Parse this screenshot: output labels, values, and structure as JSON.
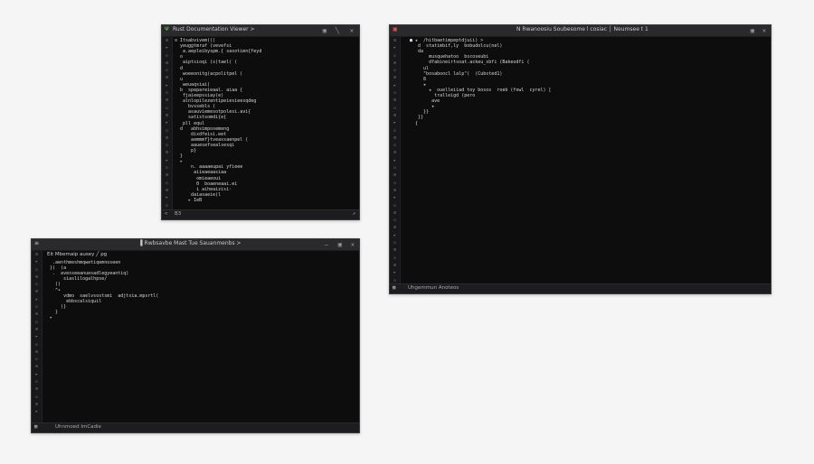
{
  "windows": [
    {
      "title": "Rust Documentation Viewer  >",
      "title_icon": "Ψ",
      "controls": [
        "▣",
        "╲",
        "✕"
      ],
      "status": "B3",
      "status_right": "↗",
      "gutter": [
        "≡",
        "▸",
        "▫",
        "≡",
        "▫",
        "≡",
        "▸",
        "▫",
        "≡",
        "▫",
        "≡",
        "▸",
        "▫",
        "≡",
        "▫",
        "≡",
        "▸",
        "▫",
        "≡",
        "▫",
        "≡",
        "▸",
        "▫",
        "≡",
        "▫"
      ],
      "lines": [
        {
          "t": "≡ Itsabvivem(()",
          "c": "c-white"
        },
        {
          "t": "  yeuggtmraf (vevefsi",
          "c": "c-white"
        },
        {
          "t": "   a.aepleibyspm.{ sasotimn{feyd",
          "c": "c-blue"
        },
        {
          "t": "  o",
          "c": "c-white"
        },
        {
          "t": "   aiptsioqi (s)tael( (",
          "c": "c-white"
        },
        {
          "t": "  d",
          "c": "c-white"
        },
        {
          "t": "   woeeonitg(acpolitpel (",
          "c": "c-white"
        },
        {
          "t": "  u",
          "c": "c-white"
        },
        {
          "t": "   weuaqsiai)",
          "c": "c-white"
        },
        {
          "t": "  b  spepareieaal. aiaa {",
          "c": "c-white"
        },
        {
          "t": "   fjaieepssiay(e)",
          "c": "c-white"
        },
        {
          "t": "   alnlopilezentipeiesieesqdeg",
          "c": "c-cyan"
        },
        {
          "t": "     bvssebls (",
          "c": "c-white"
        },
        {
          "t": "     asauviemesotpolesi.avi{",
          "c": "c-white"
        },
        {
          "t": "     satistsomdi{e{",
          "c": "c-white"
        },
        {
          "t": "   pll equl",
          "c": "c-white"
        },
        {
          "t": "  d   abhsimposemeng",
          "c": "c-white"
        },
        {
          "t": "      dixdfeisi.eet",
          "c": "c-white"
        },
        {
          "t": "      aemmmf}tveaxsaenpel (",
          "c": "c-white"
        },
        {
          "t": "      aauesefsealsesqi",
          "c": "c-white"
        },
        {
          "t": "      p}",
          "c": "c-white"
        },
        {
          "t": "  }",
          "c": "c-white"
        },
        {
          "t": "  ▸",
          "c": "c-white"
        },
        {
          "t": "      n. aaaaeupai yfieee",
          "c": "c-cyan"
        },
        {
          "t": "       aiieaeaasiaa",
          "c": "c-white"
        },
        {
          "t": "        omieaeoui",
          "c": "c-white"
        },
        {
          "t": "        0  boaeneaai.ei",
          "c": "c-white"
        },
        {
          "t": "        i aiheaizisi·",
          "c": "c-white"
        },
        {
          "t": "      daiasaeie(l",
          "c": "c-white"
        },
        {
          "t": "     ▸ IeB",
          "c": "c-white"
        }
      ]
    },
    {
      "title": "N Rwanoosiu Soubesome l cosiac │ Neumsee t 1",
      "title_icon": "▣",
      "controls": [
        "▣",
        "✕"
      ],
      "status": "Uhgemmun Anoteos",
      "status_right": "",
      "gutter": [
        "≡",
        "▸",
        "▫",
        "≡",
        "▫",
        "≡",
        "▸",
        "▫",
        "≡",
        "▫",
        "≡",
        "▸",
        "▫",
        "≡",
        "▫",
        "≡",
        "▸",
        "▫",
        "≡",
        "▫",
        "≡",
        "▸",
        "▫",
        "≡",
        "▫",
        "≡",
        "▸",
        "▫",
        "≡",
        "▫",
        "≡",
        "▸",
        "▫",
        "≡"
      ],
      "lines": [
        {
          "t": "■ ★  /hitbaetimpeptdjuii) >",
          "c": "c-white"
        },
        {
          "t": "   d  statimbif,ly  bobudolcu(nel)",
          "c": "c-white"
        },
        {
          "t": "   da",
          "c": "c-white"
        },
        {
          "t": "       musquehatoo  bscoseubi",
          "c": "c-white"
        },
        {
          "t": "       dfabineirtsoat.ackeu_sbfi (Bakeodfi (",
          "c": "c-yellow"
        },
        {
          "t": "     ul",
          "c": "c-white"
        },
        {
          "t": "     \"bosaboocl lalp\"(  (Cubsted1)",
          "c": "c-yellow"
        },
        {
          "t": "     8",
          "c": "c-white"
        },
        {
          "t": "     ★",
          "c": "c-white"
        },
        {
          "t": "       ★  ouelleiiad toy bosos  roeb (fowl  cyrel) [",
          "c": "c-green"
        },
        {
          "t": "         tralleigd (pero",
          "c": "c-white"
        },
        {
          "t": "        ave",
          "c": "c-white"
        },
        {
          "t": "        ★",
          "c": "c-white"
        },
        {
          "t": "     }}",
          "c": "c-white"
        },
        {
          "t": "   }}",
          "c": "c-white"
        },
        {
          "t": "  {",
          "c": "c-white"
        }
      ]
    },
    {
      "title": "▐ Rwbsavbe Mast Tue Sauanmenbs  >",
      "title_icon": "≡",
      "controls": [
        "―",
        "▣",
        "✕"
      ],
      "left_label": "Eit Mbemaip ausey ╱  pg",
      "status": "Uhnmoed ImCadie",
      "status_right": "",
      "gutter": [
        "≡",
        "▸",
        "▫",
        "≡",
        "▫",
        "≡",
        "▸",
        "▫",
        "≡",
        "▫",
        "≡",
        "▸",
        "▫",
        "≡",
        "▫",
        "≡",
        "▸",
        "▫",
        "≡",
        "▫",
        "≡",
        "▸"
      ],
      "lines": [
        {
          "t": "   .aenthmeshmqwetiqemnoseen",
          "c": "c-white"
        },
        {
          "t": "  })  (a",
          "c": "c-white"
        },
        {
          "t": "   .  avesseeanuesadlegyeantiq)",
          "c": "c-white"
        },
        {
          "t": "       siaslilogalhpse/",
          "c": "c-white"
        },
        {
          "t": "    ))",
          "c": "c-white"
        },
        {
          "t": "    ^•",
          "c": "c-white"
        },
        {
          "t": "       vdmo  saelvsostsmi  adjtsia.mpsrtl(",
          "c": "c-blue"
        },
        {
          "t": "        ebbscalsiquil",
          "c": "c-white"
        },
        {
          "t": "      )}",
          "c": "c-white"
        },
        {
          "t": "    }",
          "c": "c-white"
        },
        {
          "t": "  ▸",
          "c": "c-white"
        }
      ]
    }
  ]
}
